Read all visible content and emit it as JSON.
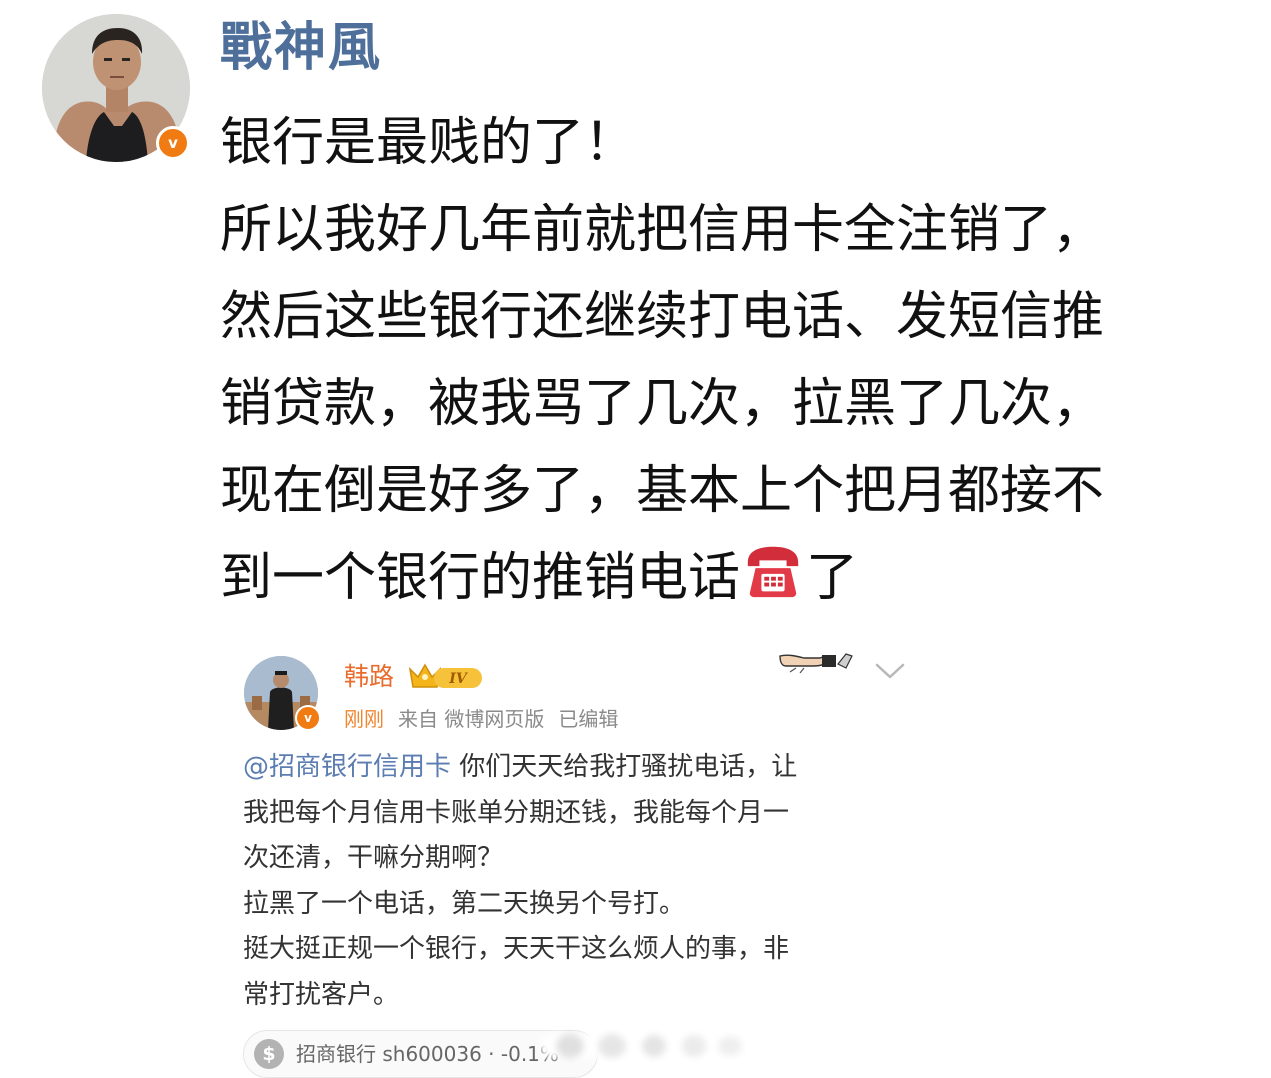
{
  "post": {
    "author_name": "戰神風",
    "lines": [
      "银行是最贱的了！",
      "所以我好几年前就把信用卡全注销了，",
      "然后这些银行还继续打电话、发短信推",
      "销贷款，被我骂了几次，拉黑了几次，",
      "现在倒是好多了，基本上个把月都接不"
    ],
    "last_line_before_emoji": "到一个银行的推销电话",
    "last_line_after_emoji": "了",
    "emoji": "telephone-icon"
  },
  "quoted": {
    "author_name": "韩路",
    "level_badge": "IV",
    "time": "刚刚",
    "source": "来自 微博网页版",
    "edited": "已编辑",
    "mention": "@招商银行信用卡",
    "first_line_rest": " 你们天天给我打骚扰电话，让",
    "lines": [
      "我把每个月信用卡账单分期还钱，我能每个月一",
      "次还清，干嘛分期啊？",
      "拉黑了一个电话，第二天换另个号打。",
      "挺大挺正规一个银行，天天干这么烦人的事，非",
      "常打扰客户。"
    ],
    "stock_tag": "招商银行 sh600036 · -0.1%"
  },
  "colors": {
    "author_blue": "#4f6f9b",
    "verified_orange": "#f07b12",
    "quoted_name_orange": "#ea6c2c",
    "mention_blue": "#5b7db1"
  }
}
